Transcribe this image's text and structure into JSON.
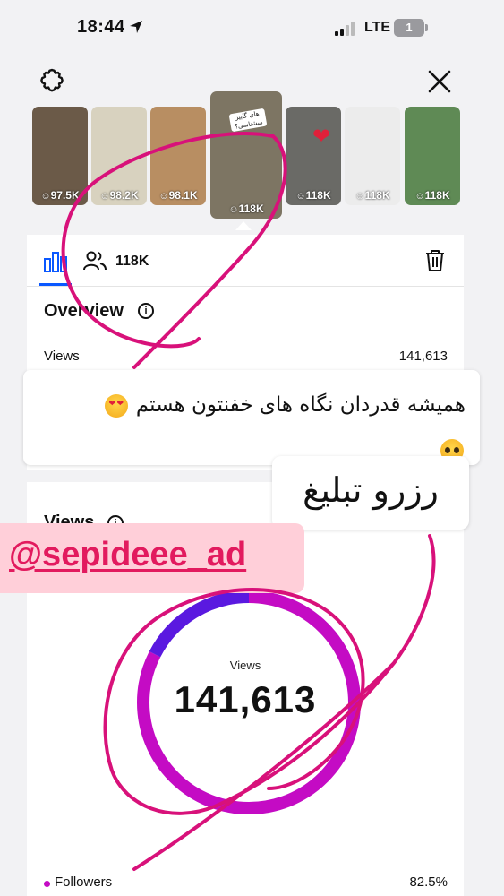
{
  "status_bar": {
    "time": "18:44",
    "network": "LTE",
    "battery": "1"
  },
  "icons": {
    "settings": "gear-icon",
    "close": "close-icon",
    "insights_tab": "bar-chart-icon",
    "audience_tab": "people-icon",
    "delete": "trash-icon"
  },
  "thumbnails": [
    {
      "count": "97.5K",
      "color": "#6b5a48"
    },
    {
      "count": "98.2K",
      "color": "#d8d2bf"
    },
    {
      "count": "98.1K",
      "color": "#b88e62"
    },
    {
      "count": "118K",
      "color": "#7d7563",
      "active": true,
      "caption": "های گاییز میشناسی؟"
    },
    {
      "count": "118K",
      "color": "#6a6a66"
    },
    {
      "count": "118K",
      "color": "#ececec"
    },
    {
      "count": "118K",
      "color": "#5f8a55"
    }
  ],
  "tabs": {
    "people_count": "118K"
  },
  "overview": {
    "title": "Overview",
    "views_label": "Views",
    "views_value": "141,613"
  },
  "views_section": {
    "title": "Views",
    "donut_label": "Views",
    "donut_value": "141,613",
    "followers_label": "Followers",
    "followers_percent": "82.5%",
    "followers_fraction": 0.825,
    "followers_color": "#c40bc4",
    "non_followers_color": "#5a19e0"
  },
  "overlays": {
    "caption": "همیشه قدردان نگاه های خفنتون هستم",
    "reserve": "رزرو تبلیغ",
    "handle": "@sepideee_ad",
    "scribble_color": "#d8117a"
  }
}
